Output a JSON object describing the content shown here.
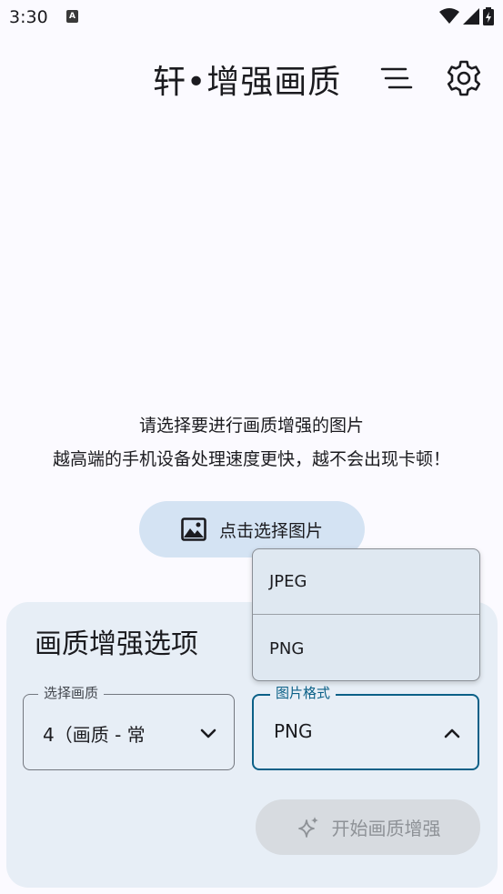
{
  "status_bar": {
    "time": "3:30",
    "notification_icon": "a-notification-icon",
    "icons": [
      "wifi-icon",
      "signal-icon",
      "battery-charging-icon"
    ]
  },
  "app_bar": {
    "title": "轩•增强画质",
    "menu_icon": "menu-lines-icon",
    "settings_icon": "gear-icon"
  },
  "hint": {
    "line1": "请选择要进行画质增强的图片",
    "line2": "越高端的手机设备处理速度更快，越不会出现卡顿！"
  },
  "pick_image_button": {
    "label": "点击选择图片",
    "icon": "image-icon"
  },
  "options": {
    "title": "画质增强选项",
    "quality_field": {
      "label": "选择画质",
      "value": "4（画质 - 常"
    },
    "format_field": {
      "label": "图片格式",
      "value": "PNG",
      "expanded": true
    },
    "format_options": [
      "JPEG",
      "PNG"
    ],
    "start_button": {
      "label": "开始画质增强",
      "icon": "sparkle-icon",
      "enabled": false
    }
  },
  "colors": {
    "background": "#fbfaff",
    "pick_button": "#d4e3f3",
    "card": "#e7eef6",
    "focus": "#0b6087",
    "disabled_button": "#d7dbe0"
  }
}
